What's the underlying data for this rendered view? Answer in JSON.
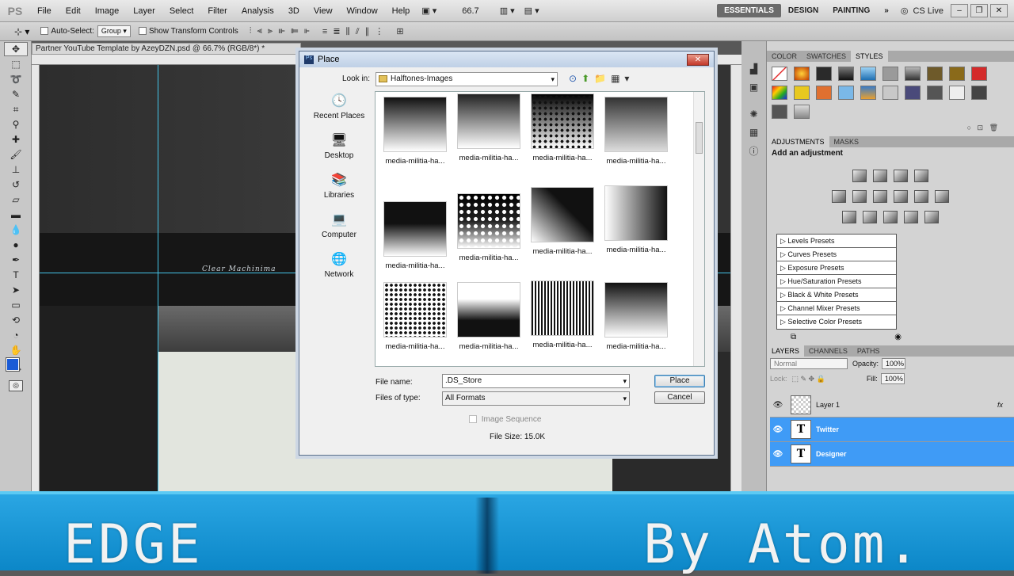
{
  "menubar": {
    "logo": "PS",
    "items": [
      "File",
      "Edit",
      "Image",
      "Layer",
      "Select",
      "Filter",
      "Analysis",
      "3D",
      "View",
      "Window",
      "Help"
    ],
    "zoom": "66.7",
    "workspaces": [
      "ESSENTIALS",
      "DESIGN",
      "PAINTING"
    ],
    "workspace_more": "»",
    "cs_live": "CS Live"
  },
  "optbar": {
    "auto_select_label": "Auto-Select:",
    "auto_select_value": "Group",
    "transform_label": "Show Transform Controls"
  },
  "document": {
    "tab_title": "Partner YouTube Template by AzeyDZN.psd @ 66.7% (RGB/8*) *",
    "canvas_text": "Clear   Machinima"
  },
  "dialog": {
    "title": "Place",
    "look_in_label": "Look in:",
    "look_in_value": "Halftones-Images",
    "places": [
      {
        "label": "Recent Places",
        "icon": "recent-places-icon",
        "glyph": "🕓"
      },
      {
        "label": "Desktop",
        "icon": "desktop-icon",
        "glyph": "🖥"
      },
      {
        "label": "Libraries",
        "icon": "libraries-icon",
        "glyph": "📚"
      },
      {
        "label": "Computer",
        "icon": "computer-icon",
        "glyph": "💻"
      },
      {
        "label": "Network",
        "icon": "network-icon",
        "glyph": "🌐"
      }
    ],
    "files": [
      "media-militia-ha...",
      "media-militia-ha...",
      "media-militia-ha...",
      "media-militia-ha...",
      "media-militia-ha...",
      "media-militia-ha...",
      "media-militia-ha...",
      "media-militia-ha...",
      "media-militia-ha...",
      "media-militia-ha...",
      "media-militia-ha...",
      "media-militia-ha..."
    ],
    "file_name_label": "File name:",
    "file_name_value": ".DS_Store",
    "files_of_type_label": "Files of type:",
    "files_of_type_value": "All Formats",
    "place_button": "Place",
    "cancel_button": "Cancel",
    "image_sequence_label": "Image Sequence",
    "file_size": "File Size: 15.0K"
  },
  "panels": {
    "top_tabs": [
      "COLOR",
      "SWATCHES",
      "STYLES"
    ],
    "adjust_tabs": [
      "ADJUSTMENTS",
      "MASKS"
    ],
    "adjust_title": "Add an adjustment",
    "presets": [
      "Levels Presets",
      "Curves Presets",
      "Exposure Presets",
      "Hue/Saturation Presets",
      "Black & White Presets",
      "Channel Mixer Presets",
      "Selective Color Presets"
    ],
    "layers_tabs": [
      "LAYERS",
      "CHANNELS",
      "PATHS"
    ],
    "blend_mode": "Normal",
    "opacity_label": "Opacity:",
    "opacity_value": "100%",
    "lock_label": "Lock:",
    "fill_label": "Fill:",
    "fill_value": "100%",
    "layers": [
      {
        "name": "Layer 1",
        "type": "raster",
        "selected": false
      },
      {
        "name": "Twitter",
        "type": "text",
        "selected": true
      },
      {
        "name": "Designer",
        "type": "text",
        "selected": true
      }
    ],
    "fx": "fx"
  },
  "banner": {
    "left": "EDGE",
    "right": "By Atom."
  },
  "colors": {
    "foreground": "#1a5bd6",
    "banner": "#1a9ad8",
    "layer_selected": "#3f9bf6",
    "guide": "#43c4e8"
  }
}
